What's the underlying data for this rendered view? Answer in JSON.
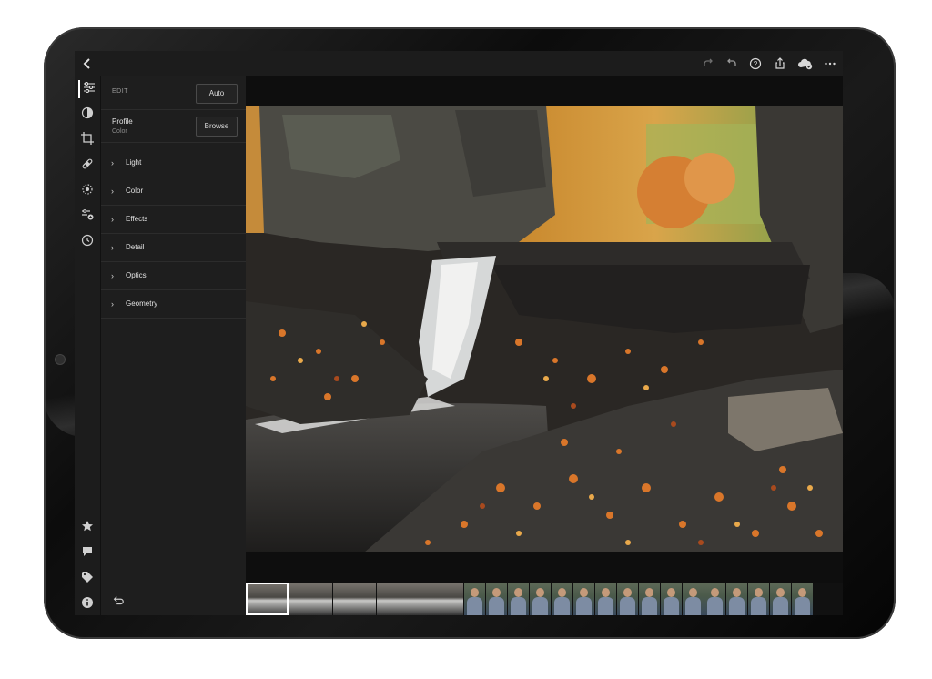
{
  "topbar": {
    "back_icon": "chevron-left-icon",
    "right_icons": [
      "redo-icon",
      "undo-icon",
      "help-icon",
      "share-icon",
      "cloud-sync-icon",
      "more-icon"
    ]
  },
  "tools": [
    "edit-sliders-icon",
    "selective-icon",
    "crop-icon",
    "healing-icon",
    "geometry-icon",
    "presets-icon",
    "versions-icon"
  ],
  "bottom_tools": [
    "star-icon",
    "comment-icon",
    "tag-icon",
    "info-icon"
  ],
  "panel": {
    "edit_label": "EDIT",
    "auto_label": "Auto",
    "profile_label": "Profile",
    "profile_value": "Color",
    "browse_label": "Browse",
    "sections": [
      "Light",
      "Color",
      "Effects",
      "Detail",
      "Optics",
      "Geometry"
    ]
  },
  "filmstrip": {
    "thumb_types": [
      "waterfall",
      "waterfall",
      "waterfall",
      "waterfall",
      "waterfall",
      "portrait",
      "portrait",
      "portrait",
      "portrait",
      "portrait",
      "portrait",
      "portrait",
      "portrait",
      "portrait",
      "portrait",
      "portrait",
      "portrait",
      "portrait",
      "portrait",
      "portrait",
      "portrait"
    ],
    "selected_index": 0
  },
  "colors": {
    "accent": "#ffffff",
    "panel": "#1e1e1e",
    "leaf_orange": "#d9762a"
  }
}
